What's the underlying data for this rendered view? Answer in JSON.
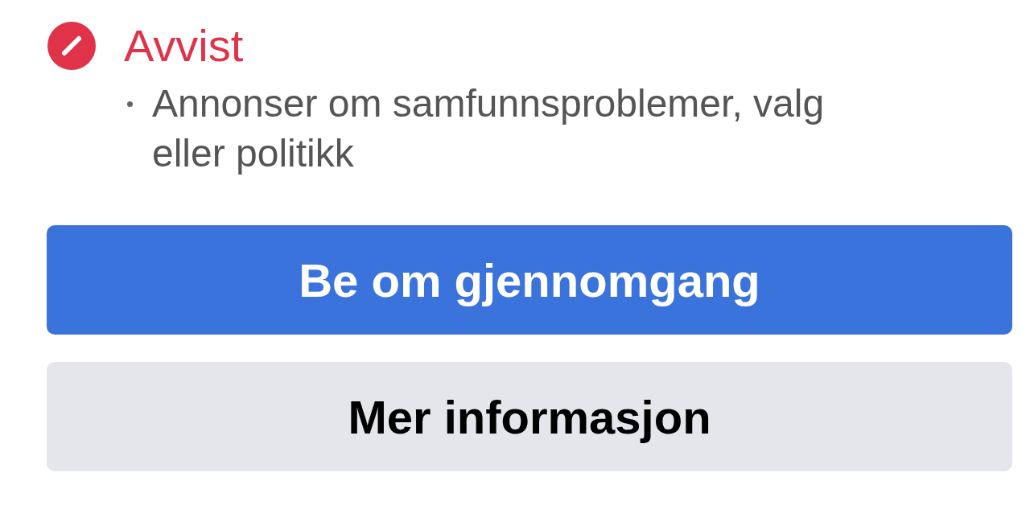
{
  "status": {
    "kind": "rejected",
    "label": "Avvist"
  },
  "items": [
    "Annonser om samfunnsproblemer, valg eller politikk"
  ],
  "buttons": [
    {
      "kind": "primary",
      "label": "Be om gjennomgang"
    },
    {
      "kind": "secondary",
      "label": "Mer informasjon"
    }
  ]
}
